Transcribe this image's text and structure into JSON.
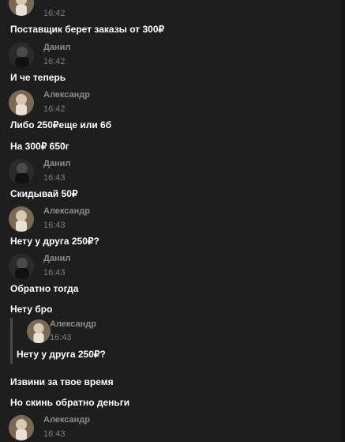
{
  "messages": [
    {
      "author": "",
      "time": "16:42",
      "text": "Поставщик берет заказы от 300₽"
    },
    {
      "author": "Данил",
      "time": "16:42",
      "text": "И че теперь"
    },
    {
      "author": "Александр",
      "time": "16:42",
      "text": "Либо 250₽еще или 6б"
    },
    {
      "text": "На 300₽ 650г"
    },
    {
      "author": "Данил",
      "time": "16:43",
      "text": "Скидывай 50₽"
    },
    {
      "author": "Александр",
      "time": "16:43",
      "text": "Нету у друга 250₽?"
    },
    {
      "author": "Данил",
      "time": "16:43",
      "text": "Обратно тогда"
    },
    {
      "text": "Нету бро"
    },
    {
      "quote": {
        "author": "Александр",
        "time": "16:43",
        "text": "Нету у друга 250₽?"
      }
    },
    {
      "text": "Извини за твое время"
    },
    {
      "text": "Но скинь обратно деньги"
    },
    {
      "author": "Александр",
      "time": "16:43"
    }
  ],
  "icons": {
    "avatar_danil": "avatar-danil-icon",
    "avatar_alexandr": "avatar-alexandr-icon"
  },
  "colors": {
    "background": "#1e1e1e",
    "name": "#8c8c8c",
    "time": "#7e7e7e",
    "text": "#ffffff",
    "quote_bar": "#4a4a4a"
  }
}
